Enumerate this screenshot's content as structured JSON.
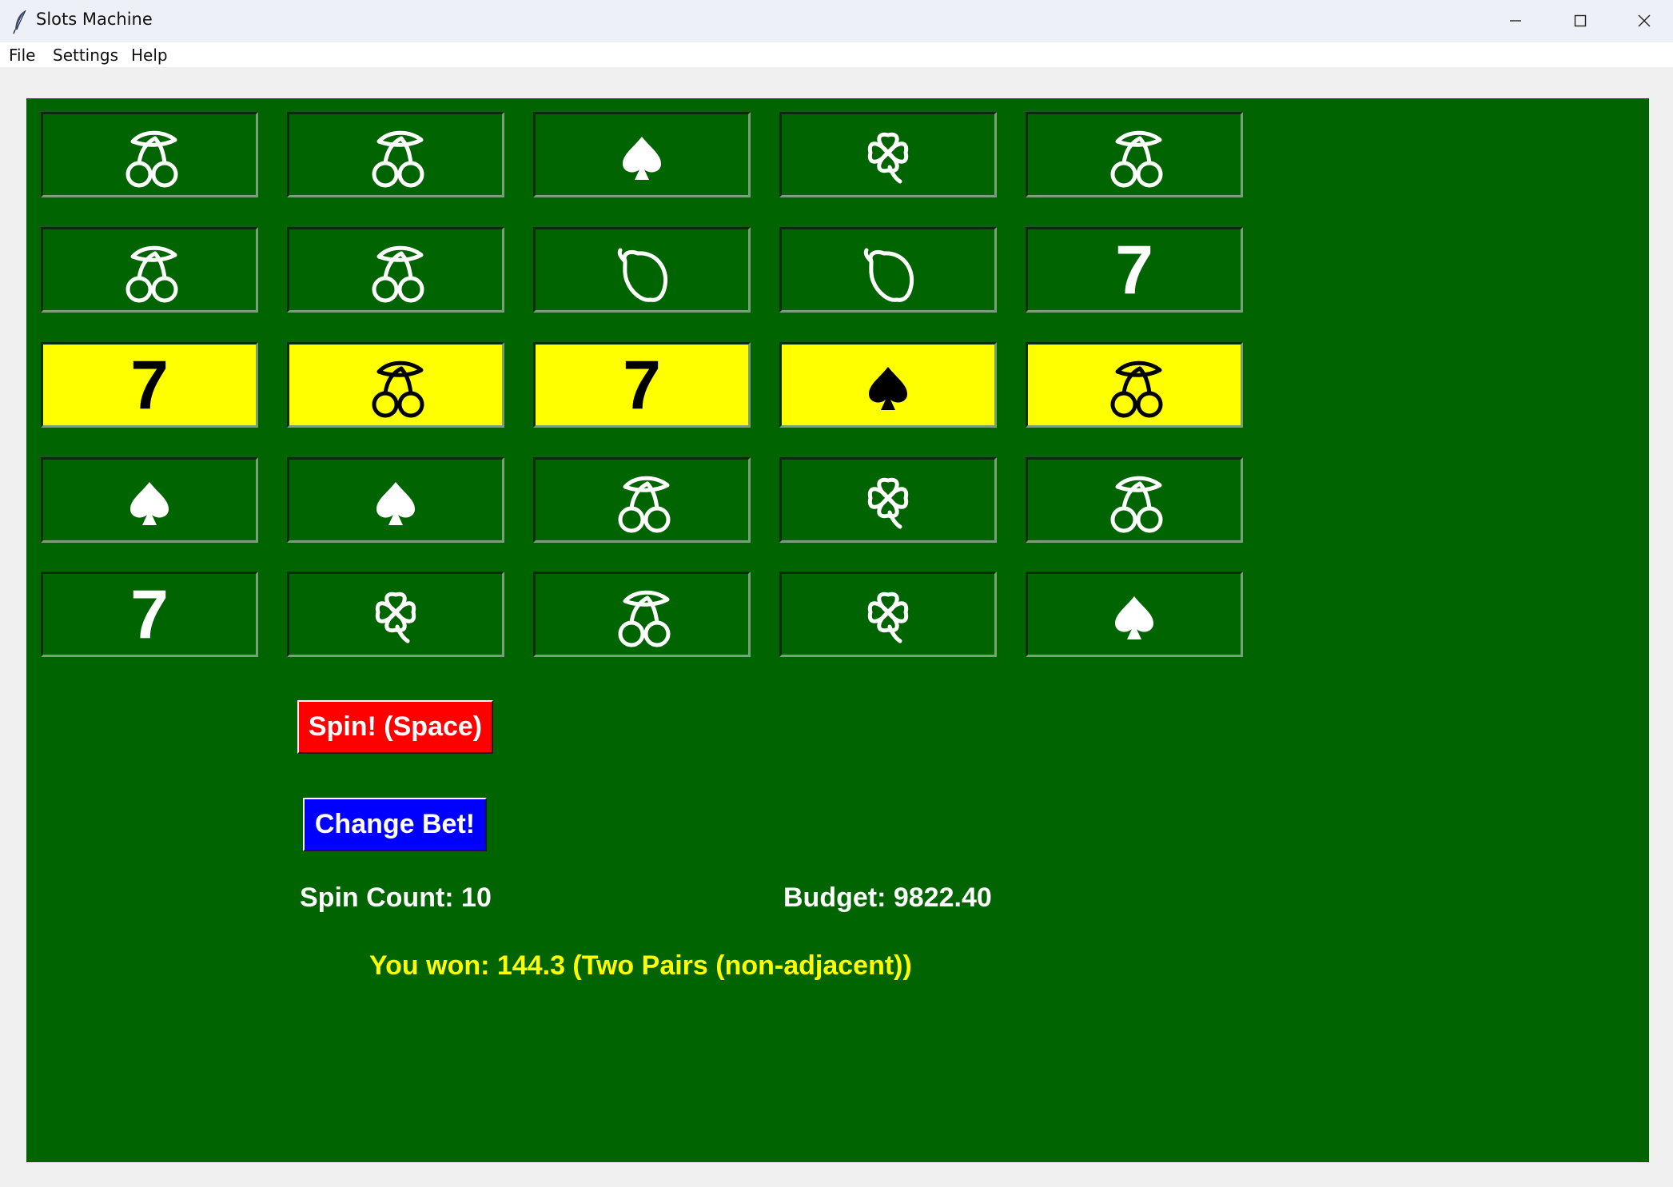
{
  "window": {
    "title": "Slots Machine"
  },
  "menu": {
    "items": [
      "File",
      "Settings",
      "Help"
    ]
  },
  "reels": {
    "rows": [
      [
        "cherry",
        "cherry",
        "spade",
        "clover",
        "cherry"
      ],
      [
        "cherry",
        "cherry",
        "lemon",
        "lemon",
        "seven"
      ],
      [
        "seven",
        "cherry",
        "seven",
        "spade",
        "cherry"
      ],
      [
        "spade",
        "spade",
        "cherry",
        "clover",
        "cherry"
      ],
      [
        "seven",
        "clover",
        "cherry",
        "clover",
        "spade"
      ]
    ],
    "seven_glyph": "7",
    "highlighted_row": 2,
    "highlight_color": "#ffff00",
    "felt_color": "#006400"
  },
  "controls": {
    "spin_label": "Spin! (Space)",
    "spin_color": "#ff0000",
    "change_bet_label": "Change Bet!",
    "change_bet_color": "#0000ff"
  },
  "status": {
    "spin_count": "Spin Count: 10",
    "budget": "Budget: 9822.40",
    "result": "You won: 144.3 (Two Pairs (non-adjacent))",
    "result_color": "#ffff00"
  }
}
